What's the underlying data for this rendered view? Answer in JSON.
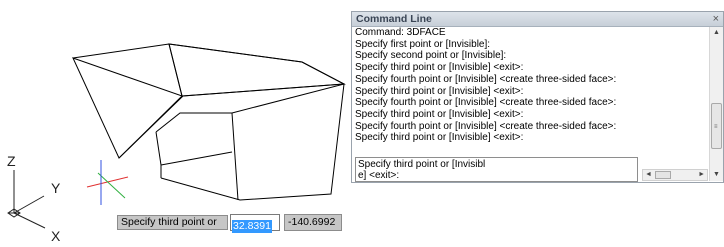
{
  "command_line": {
    "title": "Command Line",
    "close_glyph": "×",
    "history": [
      "Command: 3DFACE",
      "Specify first point or [Invisible]:",
      "Specify second point or [Invisible]:",
      "Specify third point or [Invisible] <exit>:",
      "Specify fourth point or [Invisible] <create three-sided face>:",
      "Specify third point or [Invisible] <exit>:",
      "Specify fourth point or [Invisible] <create three-sided face>:",
      "Specify third point or [Invisible] <exit>:",
      "Specify fourth point or [Invisible] <create three-sided face>:",
      "Specify third point or [Invisible] <exit>:"
    ],
    "input_line1": "Specify third point or [Invisibl",
    "input_line2": "e] <exit>:",
    "scroll_up_glyph": "▲",
    "scroll_down_glyph": "▼",
    "scroll_left_glyph": "◄",
    "scroll_right_glyph": "►",
    "grip_glyph": "≡"
  },
  "dynamic_input": {
    "prompt": "Specify third point or",
    "x_value": "32.8391",
    "y_value": "-140.6992"
  },
  "ucs_icon": {
    "z_label": "Z",
    "y_label": "Y",
    "x_label": "X"
  },
  "colors": {
    "crosshair_x": "#e03030",
    "crosshair_y": "#30b040",
    "crosshair_z": "#3050e0",
    "selection": "#3399ff"
  }
}
